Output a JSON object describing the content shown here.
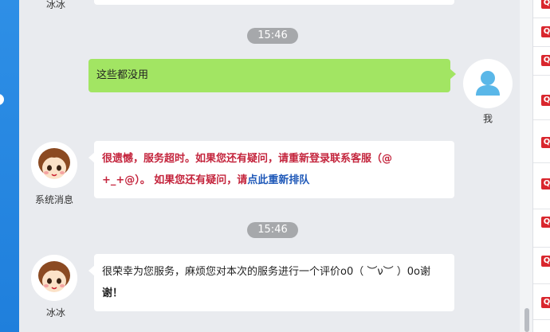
{
  "sidebar": {
    "badge_label": "Q"
  },
  "messages": {
    "top": {
      "sender": "冰冰"
    },
    "timestamp_1": "15:46",
    "me": {
      "text": "这些都没用",
      "sender": "我"
    },
    "system": {
      "sender": "系统消息",
      "line1": "很遗憾，服务超时。如果您还有疑问，请重新登录联系客服（@",
      "line2_prefix": "+_+@）。 如果您还有疑问，请",
      "link_text": "点此重新排队"
    },
    "timestamp_2": "15:46",
    "bingbing": {
      "sender": "冰冰",
      "line1": "很荣幸为您服务，麻烦您对本次的服务进行一个评价o0（ ︶ν︶ ）0o谢",
      "line2": "谢！"
    }
  },
  "colors": {
    "background": "#e9ebef",
    "my_bubble": "#a2e563",
    "system_text": "#c4253d",
    "link": "#1e58b8",
    "left_strip": "#2e8fe6",
    "badge": "#d9272e"
  },
  "icons": [
    "user-silhouette-icon",
    "cartoon-girl-avatar-icon",
    "q-badge-icon"
  ]
}
